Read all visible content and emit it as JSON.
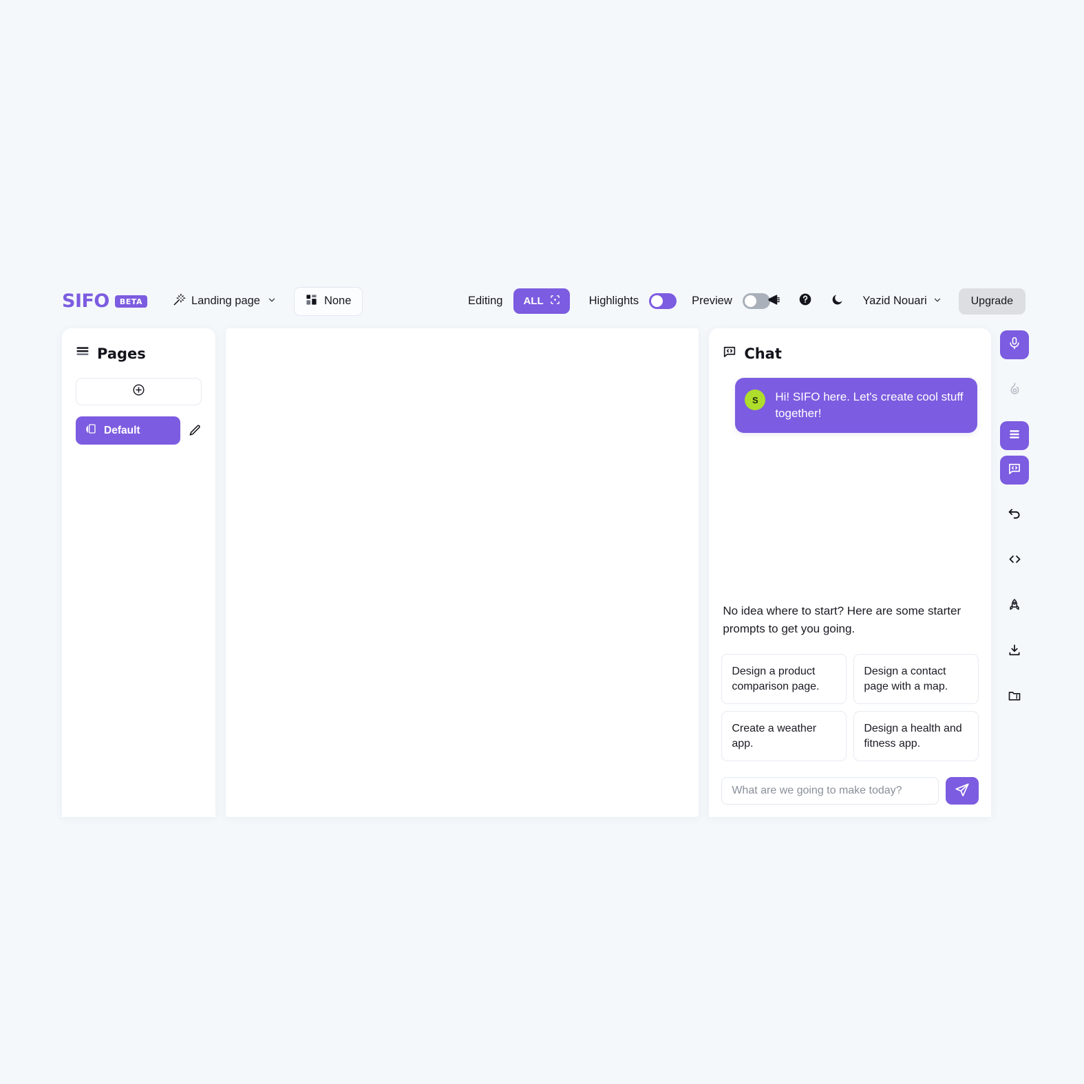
{
  "brand": {
    "name": "SIFO",
    "badge": "BETA",
    "color": "#7c5ce0"
  },
  "toolbar": {
    "page_selector_label": "Landing page",
    "layout_button_label": "None",
    "editing_label": "Editing",
    "all_pill_label": "ALL",
    "highlights_label": "Highlights",
    "highlights_on": true,
    "preview_label": "Preview",
    "preview_on": false,
    "user_name": "Yazid Nouari",
    "upgrade_label": "Upgrade"
  },
  "pages_panel": {
    "title": "Pages",
    "add_page_tooltip": "Add page",
    "items": [
      {
        "label": "Default",
        "active": true
      }
    ]
  },
  "chat_panel": {
    "title": "Chat",
    "messages": [
      {
        "avatar_initial": "S",
        "avatar_color": "#aedd2b",
        "text": "Hi! SIFO here. Let's create cool stuff together!"
      }
    ],
    "starter_intro": "No idea where to start? Here are some starter prompts to get you going.",
    "starter_prompts": [
      "Design a product comparison page.",
      "Design a contact page with a map.",
      "Create a weather app.",
      "Design a health and fitness app."
    ],
    "input_placeholder": "What are we going to make today?",
    "input_value": ""
  },
  "rail": {
    "items": [
      {
        "icon": "microphone-icon",
        "active": true
      },
      {
        "icon": "flame-icon",
        "active": false
      },
      {
        "icon": "layers-icon",
        "active": true
      },
      {
        "icon": "chat-code-icon",
        "active": true
      },
      {
        "icon": "undo-icon",
        "active": false
      },
      {
        "icon": "code-icon",
        "active": false
      },
      {
        "icon": "rocket-icon",
        "active": false
      },
      {
        "icon": "download-icon",
        "active": false
      },
      {
        "icon": "folder-pages-icon",
        "active": false
      }
    ]
  }
}
